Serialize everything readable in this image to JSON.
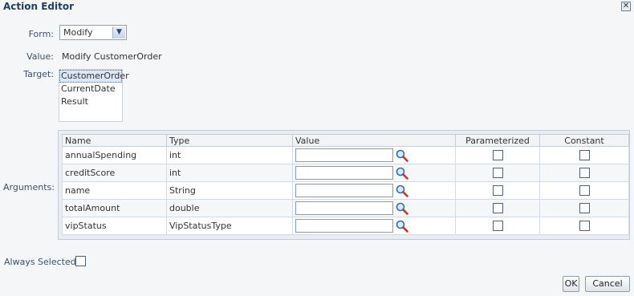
{
  "window": {
    "title": "Action Editor",
    "close_glyph": "✕"
  },
  "form": {
    "label": "Form:",
    "selected": "Modify",
    "dropdown_icon": "chevron-down-icon"
  },
  "value": {
    "label": "Value:",
    "text": "Modify CustomerOrder"
  },
  "target": {
    "label": "Target:",
    "items": [
      "CustomerOrder",
      "CurrentDate",
      "Result"
    ],
    "selected_index": 0
  },
  "arguments": {
    "label": "Arguments:",
    "columns": [
      "Name",
      "Type",
      "Value",
      "Parameterized",
      "Constant"
    ],
    "rows": [
      {
        "name": "annualSpending",
        "type": "int",
        "value": "",
        "parameterized": false,
        "constant": false
      },
      {
        "name": "creditScore",
        "type": "int",
        "value": "",
        "parameterized": false,
        "constant": false
      },
      {
        "name": "name",
        "type": "String",
        "value": "",
        "parameterized": false,
        "constant": false
      },
      {
        "name": "totalAmount",
        "type": "double",
        "value": "",
        "parameterized": false,
        "constant": false
      },
      {
        "name": "vipStatus",
        "type": "VipStatusType",
        "value": "",
        "parameterized": false,
        "constant": false
      }
    ]
  },
  "always_selected": {
    "label": "Always Selected:",
    "checked": false
  },
  "buttons": {
    "ok": "OK",
    "cancel": "Cancel"
  }
}
